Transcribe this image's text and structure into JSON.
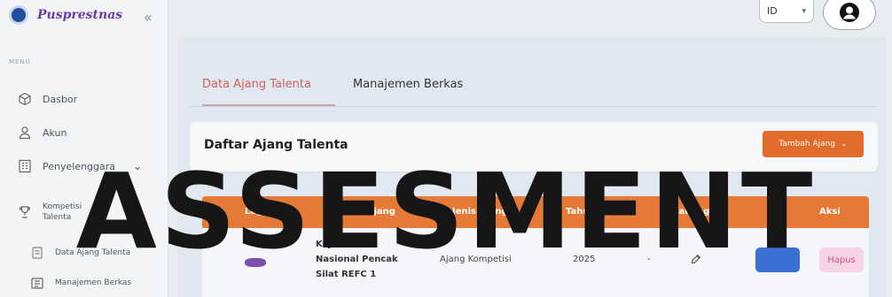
{
  "brand": {
    "name": "Pusprestnas"
  },
  "sidebar": {
    "menu_caption": "MENU",
    "items": [
      {
        "label": "Dasbor",
        "icon": "cube-icon"
      },
      {
        "label": "Akun",
        "icon": "user-icon"
      },
      {
        "label": "Penyelenggara",
        "icon": "building-icon",
        "expandable": true
      },
      {
        "label": "Kompetisi Talenta",
        "icon": "trophy-icon",
        "expandable": true
      },
      {
        "label": "Data Ajang Talenta",
        "icon": "document-icon"
      },
      {
        "label": "Manajemen Berkas",
        "icon": "folder-icon"
      }
    ]
  },
  "header": {
    "language": "ID"
  },
  "tabs": [
    {
      "label": "Data Ajang Talenta",
      "active": true
    },
    {
      "label": "Manajemen Berkas",
      "active": false
    }
  ],
  "card": {
    "title": "Daftar Ajang Talenta",
    "add_button": "Tambah Ajang"
  },
  "table": {
    "columns": [
      "Logo",
      "Nama Ajang",
      "Jenis Ajang",
      "Tahun",
      "Cabang",
      "Aksi"
    ],
    "rows": [
      {
        "name_line1": "Kejuaraan",
        "name_line2": "Nasional Pencak",
        "name_line3": "Silat REFC 1",
        "jenis": "Ajang Kompetisi",
        "tahun": "2025",
        "cabang": "-",
        "delete_label": "Hapus"
      }
    ]
  },
  "watermark": "ASSESMENT",
  "colors": {
    "accent": "#e06b2a",
    "table_header": "#e57a37",
    "tab_active": "#d25e5e",
    "brand": "#6b3aa8",
    "detail_button": "#3a6fd4"
  }
}
